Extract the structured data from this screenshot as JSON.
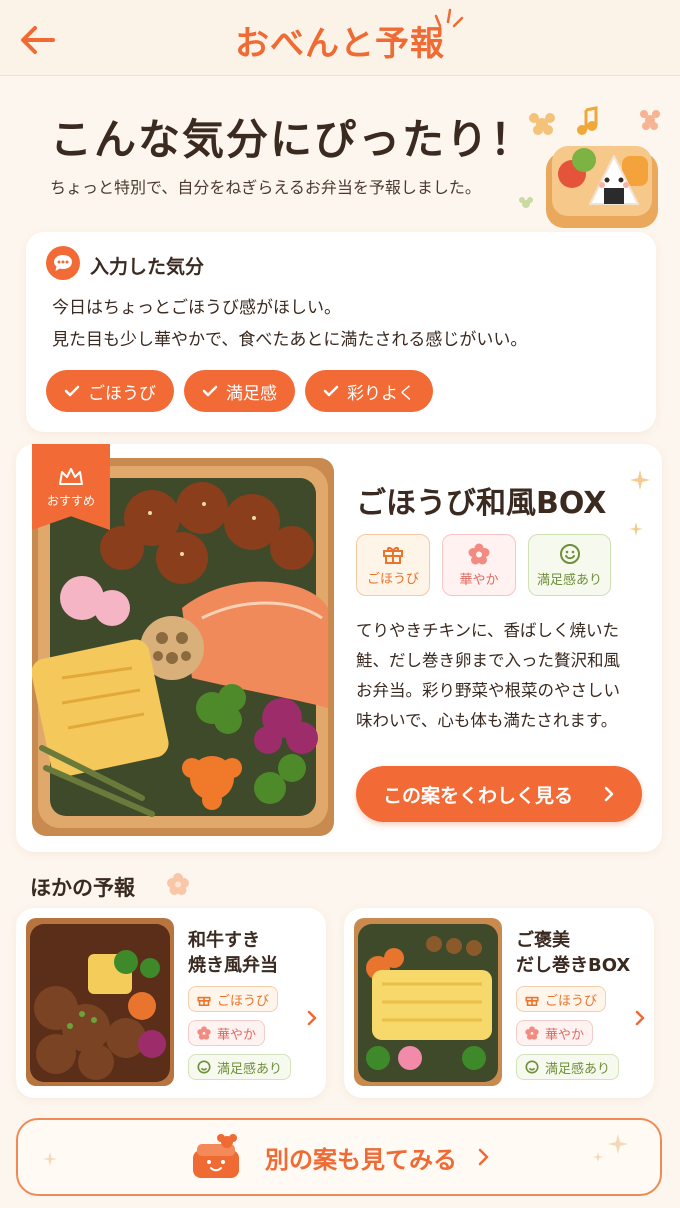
{
  "header": {
    "title": "おべんと予報"
  },
  "hero": {
    "title": "こんな気分にぴったり！",
    "subtitle": "ちょっと特別で、自分をねぎらえるお弁当を予報しました。"
  },
  "mood": {
    "label": "入力した気分",
    "line1": "今日はちょっとごほうび感がほしい。",
    "line2": "見た目も少し華やかで、食べたあとに満たされる感じがいい。",
    "chips": [
      "ごほうび",
      "満足感",
      "彩りよく"
    ]
  },
  "main": {
    "badge": "おすすめ",
    "title": "ごほうび和風BOX",
    "tags": [
      "ごほうび",
      "華やか",
      "満足感あり"
    ],
    "desc": [
      "てりやきチキンに、香ばしく焼いた",
      "鮭、だし巻き卵まで入った贅沢和風",
      "お弁当。彩り野菜や根菜のやさしい",
      "味わいで、心も体も満たされます。"
    ],
    "button": "この案をくわしく見る"
  },
  "others": {
    "title": "ほかの予報",
    "items": [
      {
        "title1": "和牛すき",
        "title2": "焼き風弁当",
        "tags": [
          "ごほうび",
          "華やか",
          "満足感あり"
        ]
      },
      {
        "title1": "ご褒美",
        "title2": "だし巻きBOX",
        "tags": [
          "ごほうび",
          "華やか",
          "満足感あり"
        ]
      }
    ]
  },
  "bottom": {
    "label": "別の案も見てみる"
  },
  "colors": {
    "accent": "#f26a35",
    "background": "#fdf6ee"
  }
}
